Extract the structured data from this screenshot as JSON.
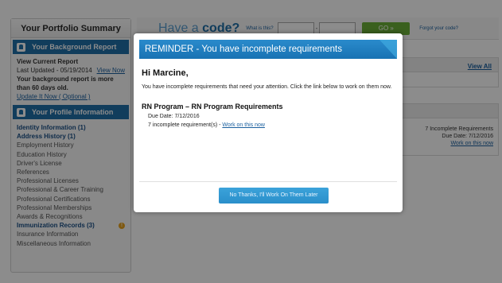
{
  "sidebar": {
    "title": "Your Portfolio Summary",
    "background_section": {
      "heading": "Your Background Report",
      "view_current": "View Current Report",
      "last_updated": "Last Updated - 05/19/2014",
      "view_now": "View Now",
      "warning": "Your background report is more than 60 days old.",
      "update_link": "Update It Now ( Optional )"
    },
    "profile_section": {
      "heading": "Your Profile Information",
      "items": [
        {
          "label": "Identity Information (1)",
          "bold": true
        },
        {
          "label": "Address History (1)",
          "bold": true
        },
        {
          "label": "Employment History",
          "bold": false
        },
        {
          "label": "Education History",
          "bold": false
        },
        {
          "label": "Driver's License",
          "bold": false
        },
        {
          "label": "References",
          "bold": false
        },
        {
          "label": "Professional Licenses",
          "bold": false
        },
        {
          "label": "Professional & Career Training",
          "bold": false
        },
        {
          "label": "Professional Certifications",
          "bold": false
        },
        {
          "label": "Professional Memberships",
          "bold": false
        },
        {
          "label": "Awards & Recognitions",
          "bold": false
        },
        {
          "label": "Immunization Records (3)",
          "bold": true
        },
        {
          "label": "Insurance Information",
          "bold": false
        },
        {
          "label": "Miscellaneous Information",
          "bold": false
        }
      ],
      "warning_glyph": "!"
    }
  },
  "code_bar": {
    "title_prefix": "Have a ",
    "title_bold": "code?",
    "what_is_this": "What is this?",
    "dash": "-",
    "go_label": "GO »",
    "forgot": "Forgot your code?"
  },
  "main": {
    "view_all": "View All",
    "requirements": {
      "count_text": "7 Incomplete Requirements",
      "due": "Due Date: 7/12/2016",
      "link": "Work on this now"
    }
  },
  "modal": {
    "title": "REMINDER - You have incomplete requirements",
    "greeting": "Hi Marcine,",
    "intro": "You have incomplete requirements that need your attention. Click the link below to work on them now.",
    "program": "RN Program – RN Program Requirements",
    "due": "Due Date: 7/12/2016",
    "incomplete_text": "7 incomplete requirement(s) - ",
    "work_link": "Work on this now",
    "later_button": "No Thanks, I'll Work On Them Later"
  },
  "colors": {
    "brand_blue": "#1f6fa8",
    "go_green": "#6aaf37",
    "warning_orange": "#e8a31e"
  }
}
